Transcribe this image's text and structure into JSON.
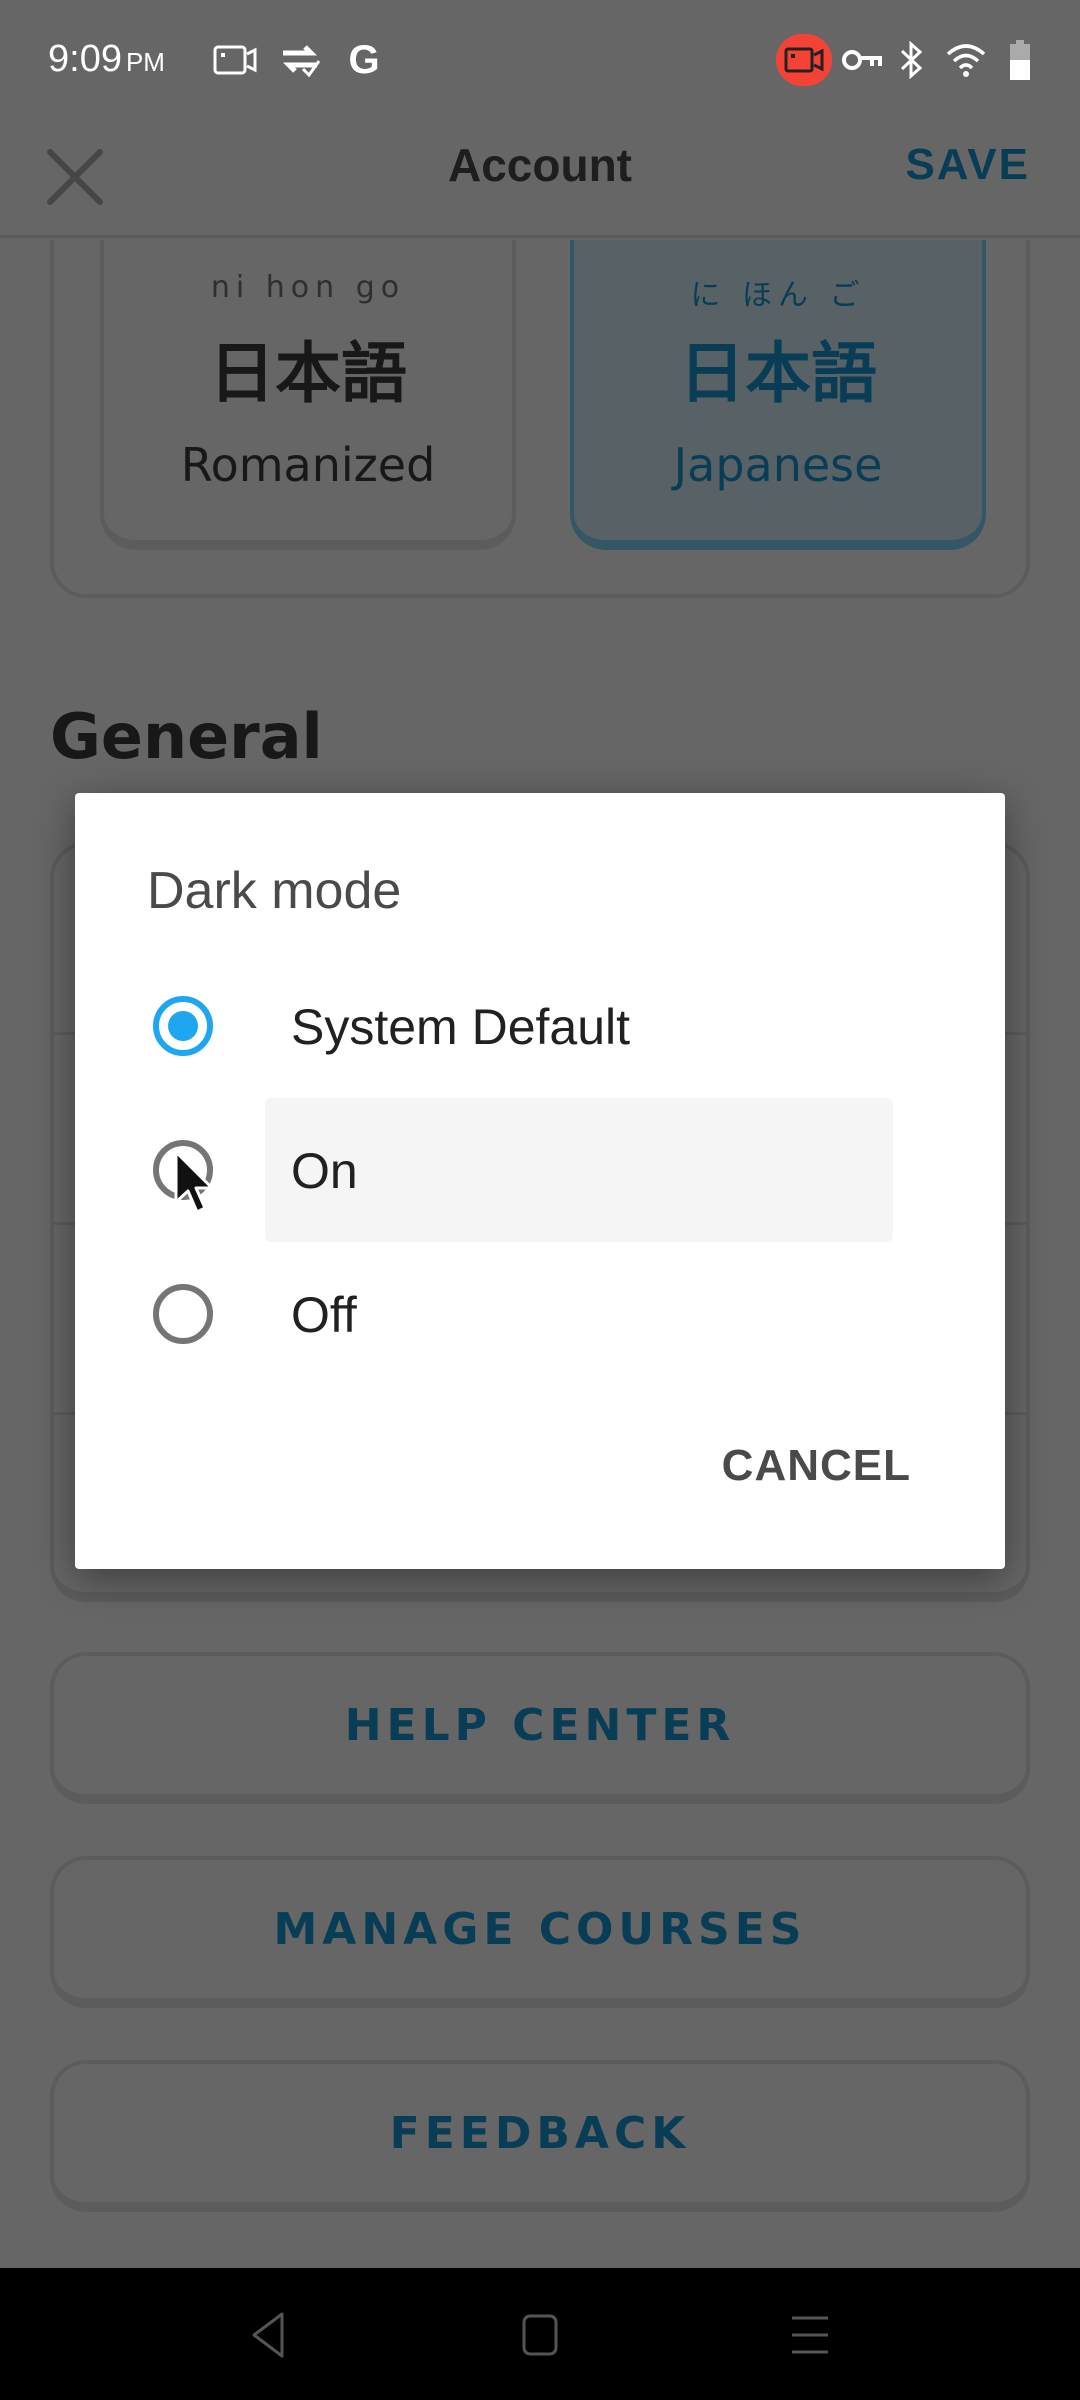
{
  "status_bar": {
    "time": "9:09",
    "ampm": "PM",
    "left_icons": [
      "screen-record-icon",
      "sync-check-icon",
      "google-icon"
    ],
    "google_glyph": "G",
    "right_icons": [
      "recording-badge-icon",
      "vpn-key-icon",
      "bluetooth-icon",
      "wifi-icon",
      "battery-icon"
    ],
    "bluetooth_glyph": "✱",
    "recording_color": "#f44336"
  },
  "app_bar": {
    "close_label": "Close",
    "title": "Account",
    "save_label": "SAVE"
  },
  "script_options": [
    {
      "furigana": "ni  hon  go",
      "kanji": "日本語",
      "label": "Romanized",
      "selected": false
    },
    {
      "furigana": "に ほん ご",
      "kanji": "日本語",
      "label": "Japanese",
      "selected": true
    }
  ],
  "section": {
    "general_title": "General"
  },
  "buttons": {
    "help_center": "HELP CENTER",
    "manage_courses": "MANAGE COURSES",
    "feedback": "FEEDBACK"
  },
  "dialog": {
    "title": "Dark mode",
    "options": [
      {
        "label": "System Default",
        "checked": true
      },
      {
        "label": "On",
        "checked": false,
        "pressed": true
      },
      {
        "label": "Off",
        "checked": false
      }
    ],
    "cancel_label": "CANCEL",
    "accent_color": "#1ea7f0"
  },
  "colors": {
    "brand_blue": "#1899d6",
    "selected_bg": "#ddf4ff",
    "scrim": "rgba(0,0,0,0.6)"
  },
  "nav_bar": {
    "items": [
      "back",
      "home",
      "recents"
    ]
  }
}
